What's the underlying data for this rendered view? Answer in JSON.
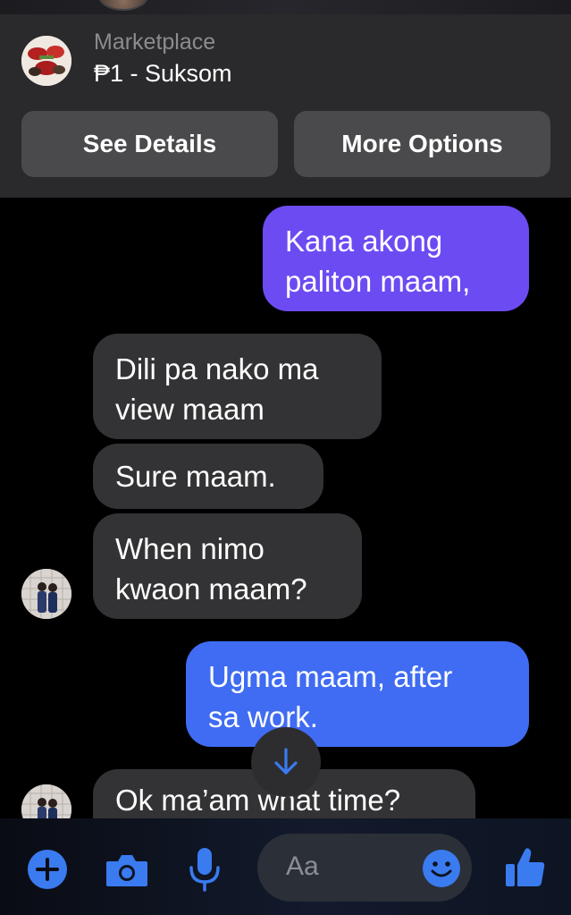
{
  "marketplace": {
    "label": "Marketplace",
    "title": "₱1 - Suksom",
    "see_details_label": "See Details",
    "more_options_label": "More Options"
  },
  "messages": [
    {
      "direction": "outgoing",
      "text": [
        "Kana akong",
        "paliton maam,"
      ]
    },
    {
      "direction": "incoming",
      "text": [
        "Dili pa nako ma",
        "view maam"
      ]
    },
    {
      "direction": "incoming",
      "text": [
        "Sure maam."
      ]
    },
    {
      "direction": "incoming",
      "text": [
        "When nimo",
        "kwaon maam?"
      ]
    },
    {
      "direction": "outgoing",
      "text": [
        "Ugma maam, after",
        "sa work."
      ]
    },
    {
      "direction": "incoming",
      "text": [
        "Ok ma’am what time?"
      ]
    }
  ],
  "composer": {
    "placeholder": "Aa"
  },
  "colors": {
    "outgoing_purple": "#6d4bf3",
    "outgoing_blue": "#3f6cf2",
    "incoming": "#333335",
    "accent": "#3a7bf0"
  },
  "icons": [
    "plus-icon",
    "camera-icon",
    "microphone-icon",
    "emoji-icon",
    "thumbs-up-icon",
    "arrow-down-icon"
  ]
}
